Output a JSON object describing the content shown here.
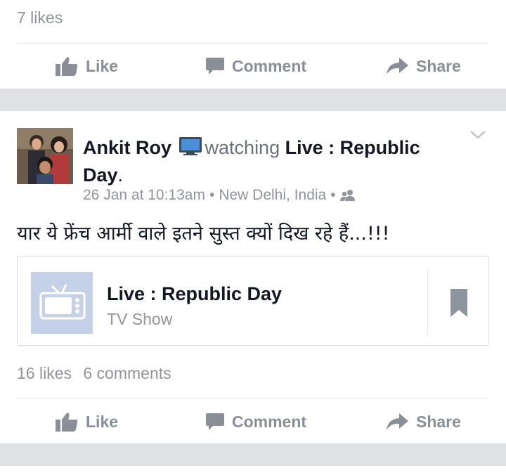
{
  "post1": {
    "likes_text": "7 likes",
    "actions": {
      "like": "Like",
      "comment": "Comment",
      "share": "Share"
    }
  },
  "post2": {
    "author": "Ankit Roy",
    "verb": "watching",
    "target": "Live : Republic Day",
    "period": ".",
    "timestamp": "26 Jan at 10:13am",
    "separator": "•",
    "location": "New Delhi, India",
    "text": "यार ये फ्रेंच आर्मी वाले इतने सुस्त क्यों दिख रहे हैं...!!!",
    "attachment": {
      "title": "Live : Republic Day",
      "subtitle": "TV Show"
    },
    "likes_text": "16 likes",
    "comments_text": "6 comments",
    "actions": {
      "like": "Like",
      "comment": "Comment",
      "share": "Share"
    }
  },
  "colors": {
    "gray_text": "#90949c",
    "action_gray": "#8a8e96",
    "thumb_bg": "#c4d1e6",
    "feed_bg": "#dfe1e4"
  },
  "icons": [
    "like-thumb-icon",
    "comment-bubble-icon",
    "share-arrow-icon",
    "tv-emoji-icon",
    "chevron-down-icon",
    "friends-icon",
    "tv-icon",
    "bookmark-icon"
  ]
}
